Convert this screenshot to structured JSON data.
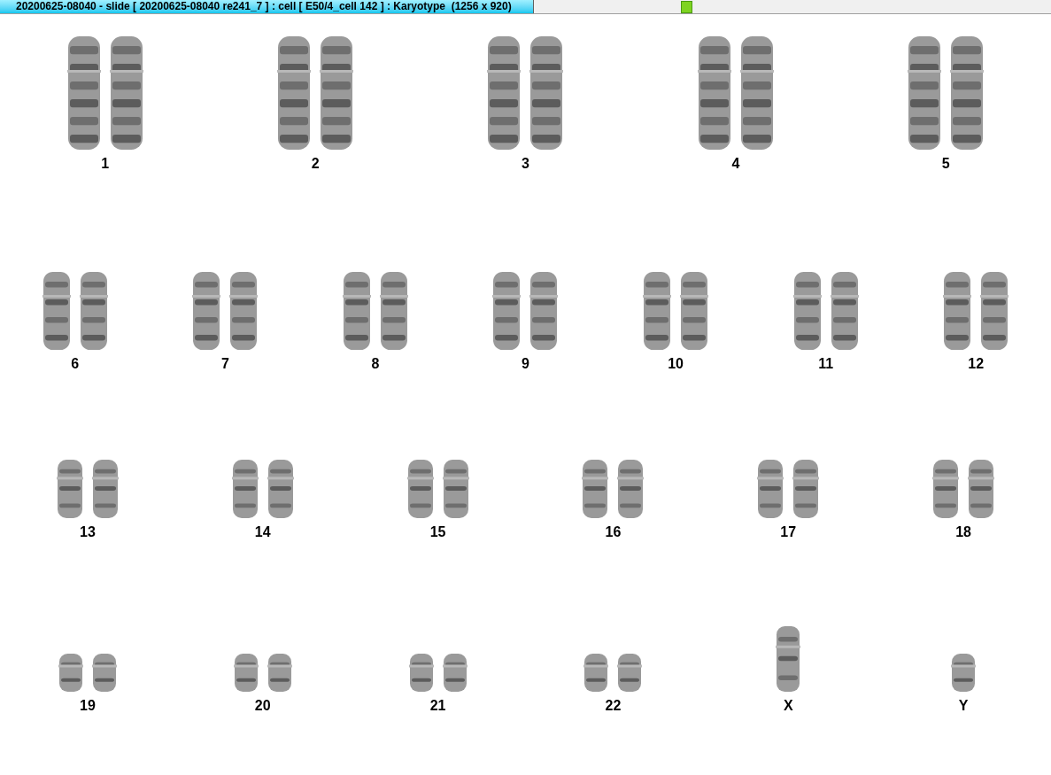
{
  "window": {
    "title": "20200625-08040 - slide [ 20200625-08040 re241_7 ] : cell [ E50/4_cell 142 ] : Karyotype  (1256 x 920)"
  },
  "rows": [
    {
      "chromosomes": [
        {
          "label": "1",
          "kind": "pair"
        },
        {
          "label": "2",
          "kind": "pair"
        },
        {
          "label": "3",
          "kind": "pair"
        },
        {
          "label": "4",
          "kind": "pair"
        },
        {
          "label": "5",
          "kind": "pair"
        }
      ]
    },
    {
      "chromosomes": [
        {
          "label": "6",
          "kind": "pair"
        },
        {
          "label": "7",
          "kind": "pair"
        },
        {
          "label": "8",
          "kind": "pair"
        },
        {
          "label": "9",
          "kind": "pair"
        },
        {
          "label": "10",
          "kind": "pair"
        },
        {
          "label": "11",
          "kind": "pair"
        },
        {
          "label": "12",
          "kind": "pair"
        }
      ]
    },
    {
      "chromosomes": [
        {
          "label": "13",
          "kind": "pair"
        },
        {
          "label": "14",
          "kind": "pair"
        },
        {
          "label": "15",
          "kind": "pair"
        },
        {
          "label": "16",
          "kind": "pair"
        },
        {
          "label": "17",
          "kind": "pair"
        },
        {
          "label": "18",
          "kind": "pair"
        }
      ]
    },
    {
      "chromosomes": [
        {
          "label": "19",
          "kind": "pair"
        },
        {
          "label": "20",
          "kind": "pair"
        },
        {
          "label": "21",
          "kind": "pair"
        },
        {
          "label": "22",
          "kind": "pair"
        },
        {
          "label": "X",
          "kind": "single"
        },
        {
          "label": "Y",
          "kind": "single"
        }
      ]
    }
  ]
}
